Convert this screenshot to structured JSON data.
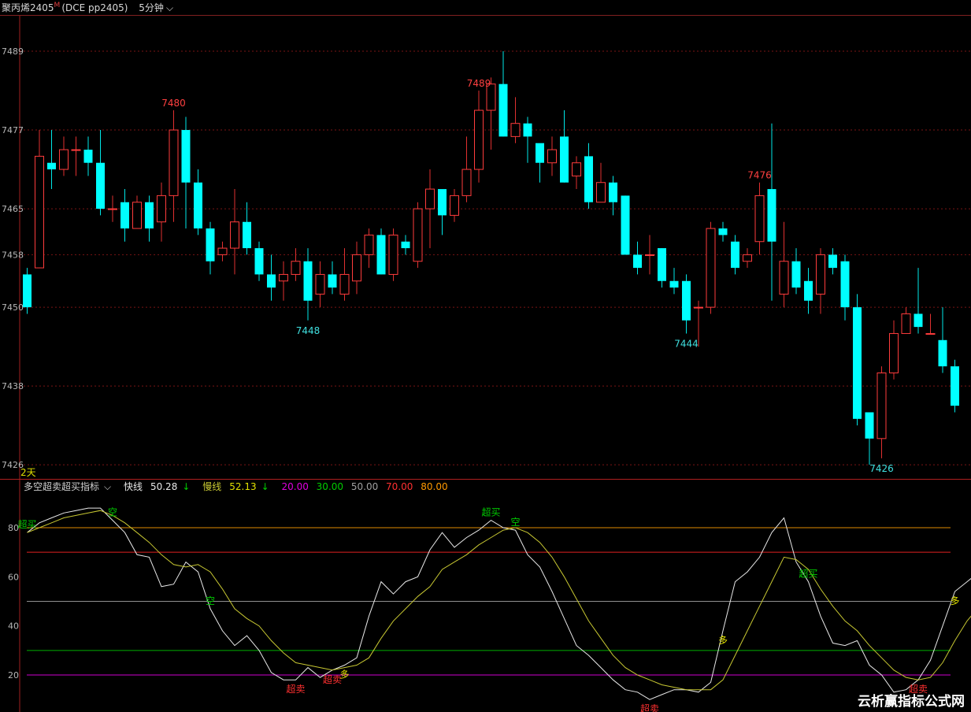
{
  "header": {
    "symbol": "聚丙烯2405",
    "marker": "M",
    "code": "(DCE pp2405)",
    "period": "5分钟",
    "period_icon": "chevron-down-icon"
  },
  "indicator_bar": {
    "name": "多空超卖超买指标",
    "name_icon": "chevron-down-icon",
    "fast_label": "快线",
    "fast_value": "50.28",
    "fast_arrow": "↓",
    "slow_label": "慢线",
    "slow_value": "52.13",
    "slow_arrow": "↓",
    "levels": [
      "20.00",
      "30.00",
      "50.00",
      "70.00",
      "80.00"
    ],
    "level_colors": [
      "#e000e0",
      "#00cc00",
      "#a0a0a0",
      "#ff3030",
      "#ff9900"
    ]
  },
  "day_marker": "2天",
  "watermark": "云析赢指标公式网",
  "chart_data": [
    {
      "type": "candlestick",
      "yticks": [
        7426,
        7438,
        7450,
        7458,
        7465,
        7477,
        7489
      ],
      "ylim": [
        7425.3,
        7491.4
      ],
      "grid": true,
      "annotations": [
        {
          "index": 12,
          "text": "7480",
          "kind": "high"
        },
        {
          "index": 23,
          "text": "7448",
          "kind": "low"
        },
        {
          "index": 37,
          "text": "7489",
          "kind": "high"
        },
        {
          "index": 54,
          "text": "7444",
          "kind": "low"
        },
        {
          "index": 60,
          "text": "7476",
          "kind": "high"
        },
        {
          "index": 70,
          "text": "7426",
          "kind": "low"
        }
      ],
      "candles": [
        [
          7455,
          7450,
          7456,
          7449
        ],
        [
          7456,
          7473,
          7477,
          7456
        ],
        [
          7472,
          7471,
          7477,
          7468
        ],
        [
          7471,
          7474,
          7476,
          7470
        ],
        [
          7474,
          7474,
          7476,
          7470
        ],
        [
          7474,
          7472,
          7476,
          7470
        ],
        [
          7472,
          7465,
          7477,
          7464
        ],
        [
          7465,
          7465,
          7467,
          7463
        ],
        [
          7466,
          7462,
          7468,
          7460
        ],
        [
          7462,
          7466,
          7467,
          7462
        ],
        [
          7466,
          7462,
          7467,
          7460
        ],
        [
          7463,
          7467,
          7469,
          7460
        ],
        [
          7467,
          7477,
          7480,
          7463
        ],
        [
          7477,
          7469,
          7479,
          7462
        ],
        [
          7469,
          7462,
          7471,
          7461
        ],
        [
          7462,
          7457,
          7463,
          7455
        ],
        [
          7458,
          7459,
          7460,
          7457
        ],
        [
          7459,
          7463,
          7468,
          7455
        ],
        [
          7463,
          7459,
          7466,
          7458
        ],
        [
          7459,
          7455,
          7460,
          7454
        ],
        [
          7455,
          7453,
          7458,
          7451
        ],
        [
          7454,
          7455,
          7457,
          7451
        ],
        [
          7455,
          7457,
          7459,
          7454
        ],
        [
          7457,
          7451,
          7459,
          7448
        ],
        [
          7452,
          7455,
          7457,
          7450
        ],
        [
          7455,
          7453,
          7457,
          7452
        ],
        [
          7452,
          7455,
          7459,
          7451
        ],
        [
          7454,
          7458,
          7460,
          7452
        ],
        [
          7458,
          7461,
          7462,
          7456
        ],
        [
          7461,
          7455,
          7462,
          7455
        ],
        [
          7455,
          7461,
          7462,
          7454
        ],
        [
          7460,
          7459,
          7461,
          7458
        ],
        [
          7457,
          7465,
          7466,
          7456
        ],
        [
          7465,
          7468,
          7471,
          7459
        ],
        [
          7468,
          7464,
          7467,
          7461
        ],
        [
          7464,
          7467,
          7468,
          7463
        ],
        [
          7467,
          7471,
          7476,
          7466
        ],
        [
          7471,
          7480,
          7483,
          7469
        ],
        [
          7480,
          7484,
          7485,
          7474
        ],
        [
          7484,
          7476,
          7489,
          7476
        ],
        [
          7476,
          7478,
          7482,
          7475
        ],
        [
          7478,
          7476,
          7479,
          7472
        ],
        [
          7475,
          7472,
          7474,
          7469
        ],
        [
          7472,
          7474,
          7476,
          7470
        ],
        [
          7476,
          7469,
          7480,
          7469
        ],
        [
          7470,
          7472,
          7473,
          7468
        ],
        [
          7473,
          7466,
          7475,
          7465
        ],
        [
          7466,
          7469,
          7472,
          7467
        ],
        [
          7469,
          7466,
          7470,
          7464
        ],
        [
          7467,
          7458,
          7467,
          7458
        ],
        [
          7458,
          7456,
          7460,
          7455
        ],
        [
          7458,
          7458,
          7461,
          7455
        ],
        [
          7459,
          7454,
          7459,
          7453
        ],
        [
          7454,
          7453,
          7456,
          7452
        ],
        [
          7454,
          7448,
          7455,
          7446
        ],
        [
          7450,
          7450,
          7451,
          7444
        ],
        [
          7450,
          7462,
          7463,
          7449
        ],
        [
          7462,
          7461,
          7463,
          7460
        ],
        [
          7460,
          7456,
          7461,
          7455
        ],
        [
          7457,
          7458,
          7459,
          7456
        ],
        [
          7460,
          7467,
          7469,
          7458
        ],
        [
          7468,
          7460,
          7478,
          7451
        ],
        [
          7452,
          7457,
          7463,
          7450
        ],
        [
          7457,
          7453,
          7459,
          7452
        ],
        [
          7454,
          7451,
          7456,
          7449
        ],
        [
          7452,
          7458,
          7459,
          7449
        ],
        [
          7458,
          7456,
          7459,
          7455
        ],
        [
          7457,
          7450,
          7458,
          7448
        ],
        [
          7450,
          7433,
          7452,
          7432
        ],
        [
          7434,
          7430,
          7434,
          7426
        ],
        [
          7430,
          7440,
          7441,
          7427
        ],
        [
          7440,
          7446,
          7448,
          7439
        ],
        [
          7446,
          7449,
          7450,
          7446
        ],
        [
          7449,
          7447,
          7456,
          7446
        ],
        [
          7446,
          7446,
          7449,
          7446
        ],
        [
          7445,
          7441,
          7450,
          7440
        ],
        [
          7441,
          7435,
          7442,
          7434
        ]
      ]
    },
    {
      "type": "line",
      "title": "多空超卖超买指标",
      "yticks": [
        20,
        40,
        60,
        80
      ],
      "ylim": [
        10,
        95
      ],
      "hlines": [
        20,
        30,
        50,
        70,
        80
      ],
      "series": [
        {
          "name": "快线",
          "color": "#e8e8e8",
          "values": [
            78,
            82,
            84,
            86,
            87,
            88,
            88,
            83,
            78,
            69,
            68,
            56,
            57,
            66,
            62,
            47,
            38,
            32,
            36,
            30,
            21,
            18,
            18,
            23,
            19,
            22,
            24,
            27,
            44,
            58,
            53,
            58,
            60,
            71,
            78,
            72,
            76,
            79,
            83,
            80,
            79,
            69,
            64,
            54,
            43,
            32,
            28,
            23,
            18,
            14,
            13,
            10,
            12,
            14,
            14,
            13,
            17,
            38,
            58,
            62,
            68,
            78,
            84,
            66,
            58,
            44,
            33,
            32,
            34,
            24,
            20,
            13,
            14,
            18,
            26,
            40,
            54,
            58,
            62,
            60,
            52,
            50
          ]
        },
        {
          "name": "慢线",
          "color": "#c8c832",
          "values": [
            78,
            80,
            82,
            84,
            85,
            86,
            87,
            85,
            82,
            78,
            74,
            69,
            65,
            64,
            65,
            62,
            55,
            47,
            43,
            40,
            34,
            29,
            25,
            24,
            23,
            22,
            23,
            24,
            27,
            35,
            42,
            47,
            52,
            56,
            63,
            66,
            69,
            73,
            76,
            79,
            80,
            78,
            74,
            68,
            60,
            51,
            42,
            35,
            28,
            23,
            20,
            18,
            16,
            15,
            14,
            14,
            14,
            18,
            28,
            38,
            48,
            58,
            68,
            67,
            63,
            55,
            48,
            42,
            38,
            32,
            27,
            22,
            19,
            18,
            19,
            25,
            34,
            42,
            48,
            52,
            54,
            52
          ]
        }
      ],
      "signals": [
        {
          "index": 0,
          "text": "超买",
          "color": "#00cc00",
          "pos": "above"
        },
        {
          "index": 7,
          "text": "空",
          "color": "#00cc00",
          "pos": "above"
        },
        {
          "index": 15,
          "text": "空",
          "color": "#00cc00",
          "pos": "above"
        },
        {
          "index": 22,
          "text": "超卖",
          "color": "#ff3030",
          "pos": "below"
        },
        {
          "index": 25,
          "text": "超卖",
          "color": "#ff3030",
          "pos": "below"
        },
        {
          "index": 26,
          "text": "多",
          "color": "#e0e000",
          "pos": "below"
        },
        {
          "index": 38,
          "text": "超买",
          "color": "#00cc00",
          "pos": "above"
        },
        {
          "index": 40,
          "text": "空",
          "color": "#00cc00",
          "pos": "above"
        },
        {
          "index": 51,
          "text": "超卖",
          "color": "#ff3030",
          "pos": "below"
        },
        {
          "index": 57,
          "text": "多",
          "color": "#e0e000",
          "pos": "below"
        },
        {
          "index": 64,
          "text": "超买",
          "color": "#00cc00",
          "pos": "above"
        },
        {
          "index": 73,
          "text": "超卖",
          "color": "#ff3030",
          "pos": "below"
        },
        {
          "index": 76,
          "text": "多",
          "color": "#e0e000",
          "pos": "below"
        }
      ]
    }
  ]
}
